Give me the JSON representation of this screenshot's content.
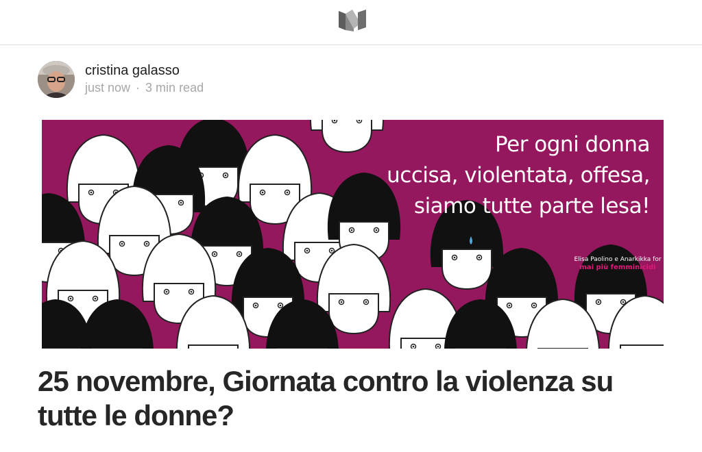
{
  "header": {
    "logo_icon": "medium-logo-icon"
  },
  "post": {
    "author": "cristina galasso",
    "timestamp": "just now",
    "separator": "·",
    "read_time": "3 min read",
    "title": "25 novembre, Giornata contro la violenza su tutte le donne?"
  },
  "hero": {
    "lines": [
      "Per ogni donna",
      "uccisa, violentata, offesa,",
      "siamo tutte parte lesa!"
    ],
    "credit_line": "Elisa Paolino e Anarkikka for",
    "credit_brand": "mai più femminicidi",
    "background_color": "#95175d"
  }
}
